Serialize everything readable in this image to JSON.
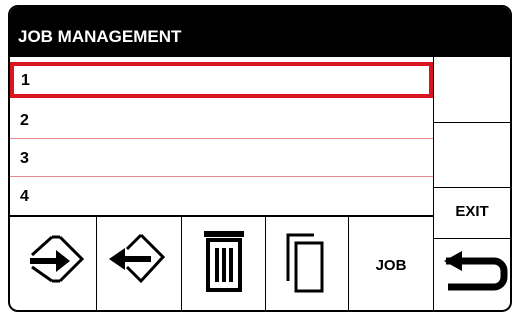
{
  "header": {
    "title": "JOB MANAGEMENT"
  },
  "jobs": [
    {
      "number": "1",
      "selected": true
    },
    {
      "number": "2",
      "selected": false
    },
    {
      "number": "3",
      "selected": false
    },
    {
      "number": "4",
      "selected": false
    }
  ],
  "toolbar": {
    "job_label": "JOB",
    "icons": [
      "store-job-icon",
      "recall-job-icon",
      "delete-icon",
      "copy-icon"
    ]
  },
  "side": {
    "exit_label": "EXIT",
    "exit_icon": "return-arrow-icon"
  },
  "colors": {
    "selection": "#d9161f",
    "row_divider": "#e48a8a",
    "header_bg": "#000000"
  }
}
